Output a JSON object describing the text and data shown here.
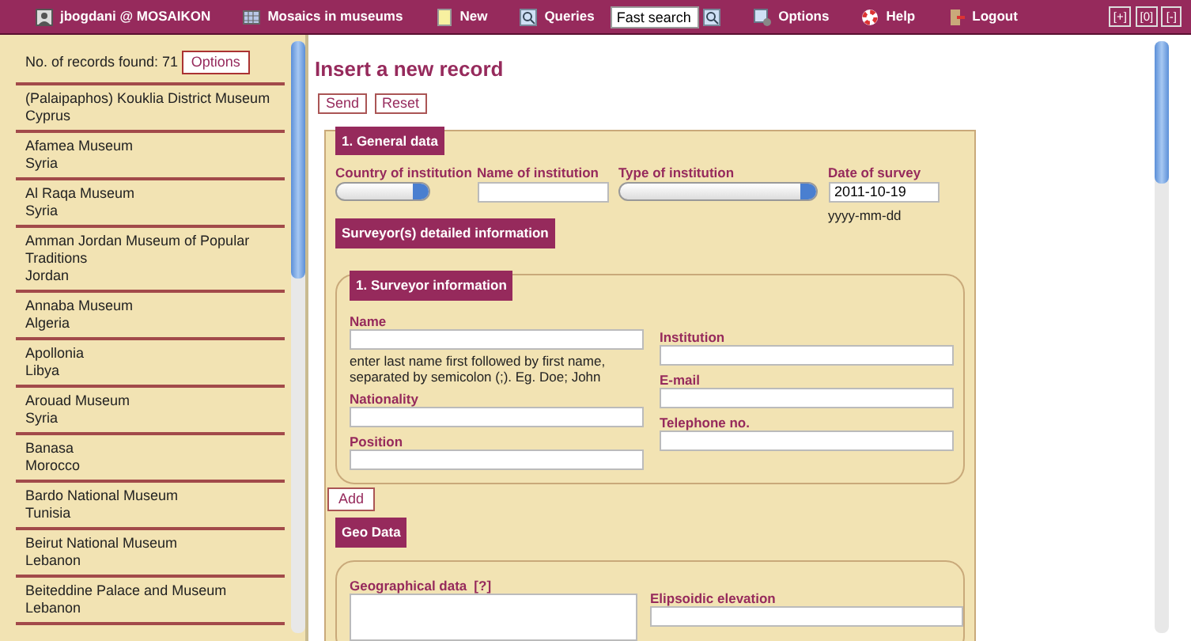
{
  "top_bar": {
    "menu": [
      {
        "label": "jbogdani @ MOSAIKON"
      },
      {
        "label": "Mosaics in museums"
      },
      {
        "label": "New"
      },
      {
        "label": "Queries"
      }
    ],
    "fast_search": {
      "value": "Fast search"
    },
    "menu_right": [
      {
        "label": "Options"
      },
      {
        "label": "Help"
      },
      {
        "label": "Logout"
      }
    ],
    "window_buttons": [
      "[+]",
      "[0]",
      "[-]"
    ]
  },
  "sidebar": {
    "records_found": "No. of records found: 71",
    "options_button": "Options",
    "records": [
      {
        "name": "(Palaipaphos) Kouklia District Museum",
        "country": "Cyprus"
      },
      {
        "name": "Afamea Museum",
        "country": "Syria"
      },
      {
        "name": "Al Raqa Museum",
        "country": "Syria"
      },
      {
        "name": "Amman Jordan Museum of Popular Traditions",
        "country": "Jordan"
      },
      {
        "name": "Annaba Museum",
        "country": "Algeria"
      },
      {
        "name": "Apollonia",
        "country": "Libya"
      },
      {
        "name": "Arouad Museum",
        "country": "Syria"
      },
      {
        "name": "Banasa",
        "country": "Morocco"
      },
      {
        "name": "Bardo National Museum",
        "country": "Tunisia"
      },
      {
        "name": "Beirut National Museum",
        "country": "Lebanon"
      },
      {
        "name": "Beiteddine Palace and Museum",
        "country": "Lebanon"
      }
    ]
  },
  "main": {
    "title": "Insert a new record",
    "buttons": [
      "Send",
      "Reset"
    ],
    "general_data": {
      "legend": "1. General data",
      "fields": [
        {
          "label": "Country of institution",
          "kind": "select"
        },
        {
          "label": "Name of institution",
          "kind": "text"
        },
        {
          "label": "Type of institution",
          "kind": "select"
        },
        {
          "label": "Date of survey",
          "kind": "text",
          "value": "2011-10-19",
          "hint": "yyyy-mm-dd"
        }
      ]
    },
    "surveyor_heading": "Surveyor(s) detailed information",
    "surveyor": {
      "legend": "1. Surveyor information",
      "left_fields": [
        {
          "label": "Name",
          "hint": "enter last name first followed by first name, separated by semicolon (;). Eg. Doe; John"
        },
        {
          "label": "Nationality"
        },
        {
          "label": "Position"
        }
      ],
      "right_fields": [
        {
          "label": "Institution"
        },
        {
          "label": "E-mail"
        },
        {
          "label": "Telephone no."
        }
      ]
    },
    "add_button": "Add",
    "geo_heading": "Geo Data",
    "geo": {
      "left_field": {
        "label": "Geographical data",
        "help": "[?]"
      },
      "right_field": {
        "label": "Elipsoidic elevation"
      }
    }
  }
}
